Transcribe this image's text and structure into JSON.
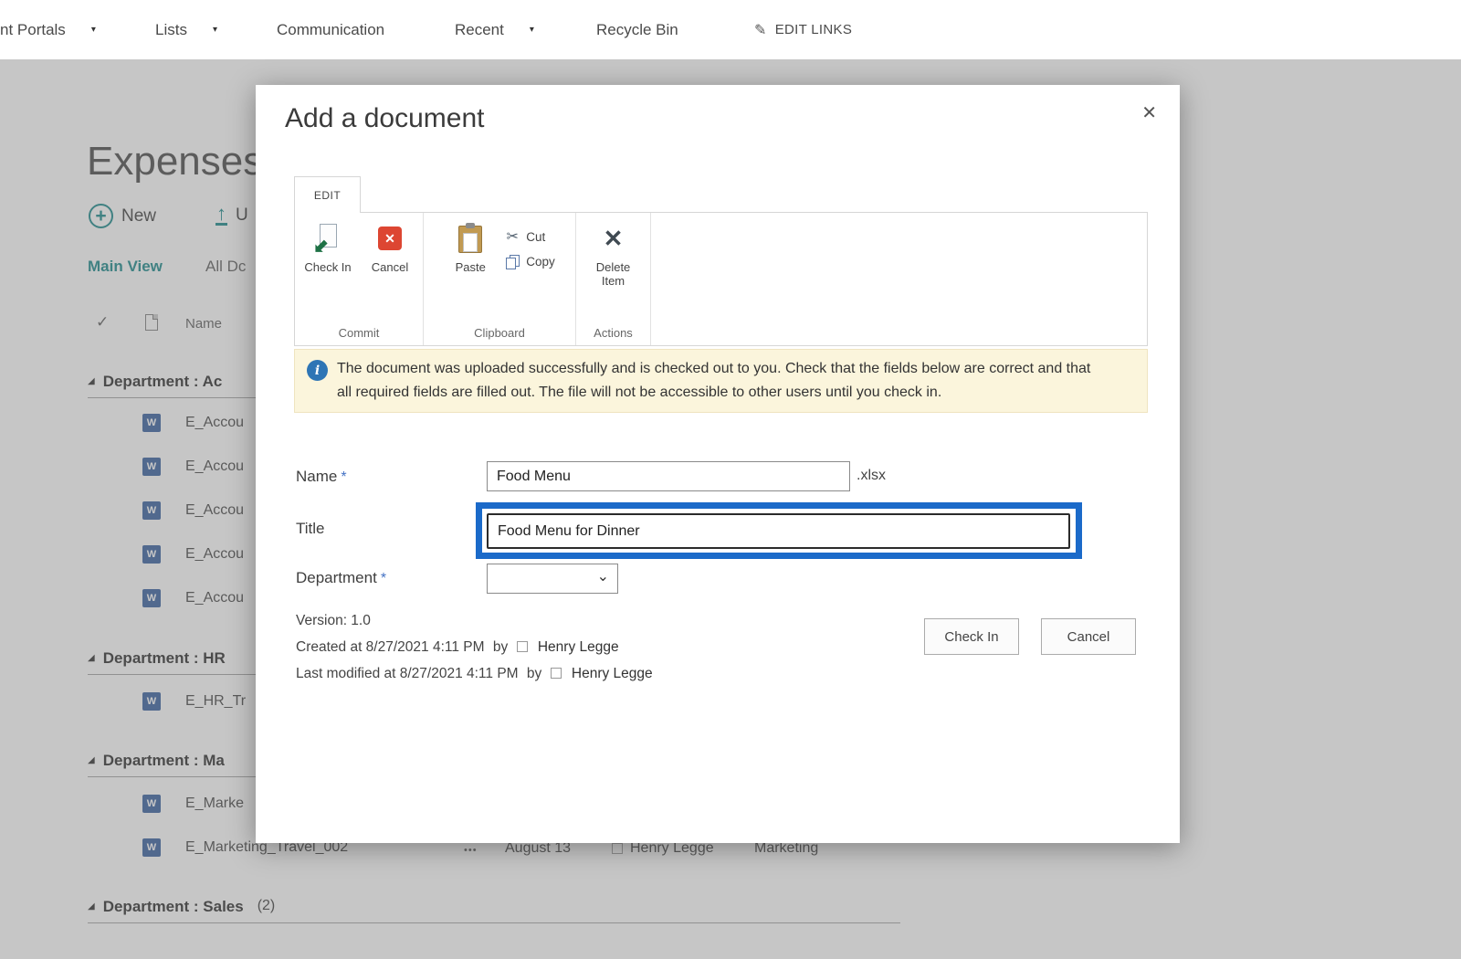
{
  "colors": {
    "highlight_blue": "#1b6ac9",
    "notice_bg": "#fbf5dc",
    "teal": "#0c8184",
    "word_blue": "#2b579a",
    "cancel_red": "#dd4632",
    "checkin_green": "#1e7145",
    "info_blue": "#2e75b5"
  },
  "icons": {
    "close": "✕",
    "info": "i",
    "caret": "▾",
    "pencil": "✎",
    "scissors": "✂",
    "delete_x": "✕",
    "cancel_x": "✕",
    "check_arrow": "⬋",
    "group_triangle": "◢",
    "checkmark": "✓",
    "ellipsis": "•••",
    "word_w": "W",
    "new_plus": "+",
    "upload_arrow": "↑",
    "select_chevron": "⌄"
  },
  "topnav": {
    "items": [
      {
        "label": "nt Portals"
      },
      {
        "label": "Lists"
      },
      {
        "label": "Communication"
      },
      {
        "label": "Recent"
      },
      {
        "label": "Recycle Bin"
      }
    ],
    "edit_links": "EDIT LINKS"
  },
  "page": {
    "title": "Expenses",
    "new_label": "New",
    "upload_label": "U",
    "view_main": "Main View",
    "view_all": "All Dc",
    "col_name": "Name",
    "groups": [
      {
        "label": "Department : Ac"
      },
      {
        "label": "Department : HR"
      },
      {
        "label": "Department : Ma"
      },
      {
        "label": "Department : Sales",
        "count": "(2)"
      }
    ],
    "files_acc": [
      "E_Accou",
      "E_Accou",
      "E_Accou",
      "E_Accou",
      "E_Accou"
    ],
    "files_hr": [
      "E_HR_Tr"
    ],
    "files_ma": [
      "E_Marke"
    ],
    "file_detail": {
      "name": "E_Marketing_Travel_002",
      "date": "August 13",
      "person": "Henry Legge",
      "dept": "Marketing"
    }
  },
  "dialog": {
    "title": "Add a document",
    "tab": "EDIT",
    "ribbon": {
      "commit_label": "Commit",
      "check_in": "Check In",
      "cancel": "Cancel",
      "clipboard_label": "Clipboard",
      "paste": "Paste",
      "cut": "Cut",
      "copy": "Copy",
      "actions_label": "Actions",
      "delete_item": "Delete Item"
    },
    "notice": "The document was uploaded successfully and is checked out to you. Check that the fields below are correct and that all required fields are filled out. The file will not be accessible to other users until you check in.",
    "form": {
      "name_label": "Name",
      "required_mark": "*",
      "name_value": "Food Menu",
      "extension": ".xlsx",
      "title_label": "Title",
      "title_value": "Food Menu for Dinner",
      "department_label": "Department"
    },
    "meta": {
      "version": "Version: 1.0",
      "created": "Created at 8/27/2021 4:11 PM",
      "by_label": "by",
      "created_by": "Henry Legge",
      "modified": "Last modified at 8/27/2021 4:11 PM",
      "modified_by": "Henry Legge"
    },
    "check_in_btn": "Check In",
    "cancel_btn": "Cancel"
  }
}
